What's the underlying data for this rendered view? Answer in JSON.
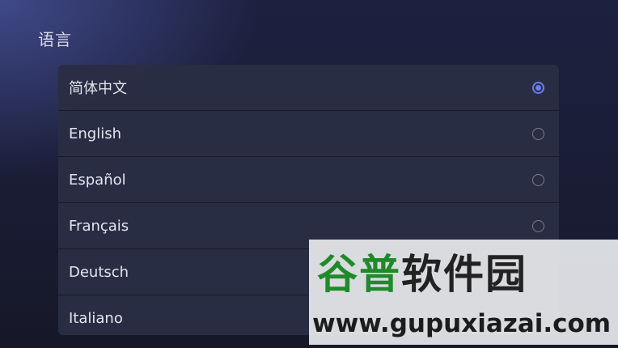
{
  "section": {
    "title": "语言"
  },
  "languages": [
    {
      "label": "简体中文",
      "selected": true
    },
    {
      "label": "English",
      "selected": false
    },
    {
      "label": "Español",
      "selected": false
    },
    {
      "label": "Français",
      "selected": false
    },
    {
      "label": "Deutsch",
      "selected": false
    },
    {
      "label": "Italiano",
      "selected": false
    }
  ],
  "watermark": {
    "logo_text_green": "谷普",
    "logo_text_dark": "软件园",
    "url": "www.gupuxiazai.com"
  },
  "colors": {
    "accent": "#6b7cf0",
    "list_bg": "#2a2d44",
    "background": "#1b1e38"
  }
}
